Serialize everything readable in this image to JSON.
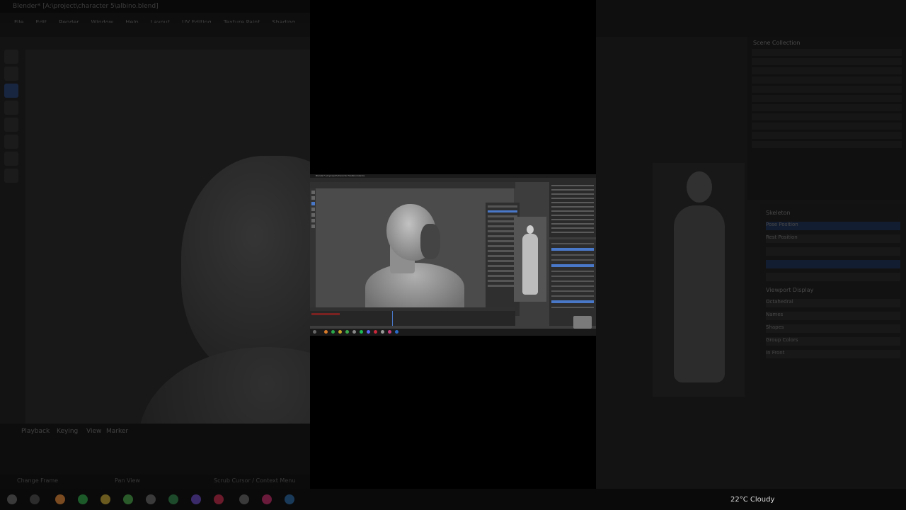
{
  "background": {
    "window_title": "Blender* [A:\\project\\character 5\\albino.blend]",
    "menu": [
      "File",
      "Edit",
      "Render",
      "Window",
      "Help"
    ],
    "workspace_tabs": [
      "Layout",
      "UV Editing",
      "Texture Paint",
      "Shading"
    ],
    "timeline_labels": [
      "Playback",
      "Keying",
      "View",
      "Marker"
    ],
    "status_left": "Change Frame",
    "status_mid": "Pan View",
    "status_right": "Scrub Cursor / Context Menu",
    "outliner_title": "Scene Collection",
    "props_section": "Skeleton",
    "pose_position": "Pose Position",
    "rest_position": "Rest Position",
    "viewport_display": "Viewport Display",
    "display_as": "Octahedral",
    "show_items": [
      "Names",
      "Shapes",
      "Group Colors",
      "In Front"
    ],
    "weather": "22°C Cloudy"
  },
  "thumbnail": {
    "title": "Blender* [A:\\project\\character 5\\albino.blend]"
  }
}
